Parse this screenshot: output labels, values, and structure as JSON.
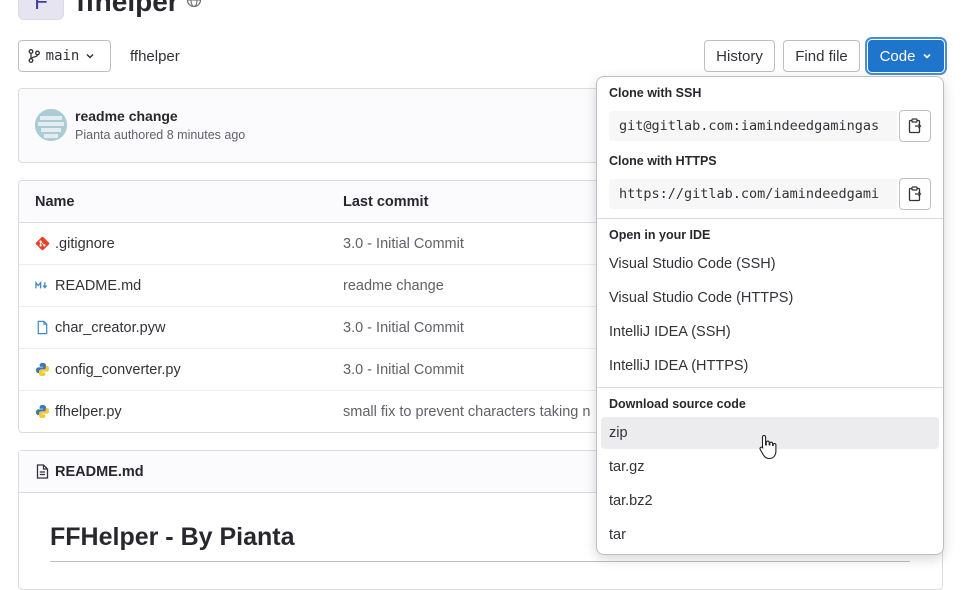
{
  "project": {
    "avatar_letter": "F",
    "name": "ffhelper"
  },
  "toolbar": {
    "branch": "main",
    "breadcrumb": "ffhelper",
    "history": "History",
    "find_file": "Find file",
    "code": "Code"
  },
  "last_commit": {
    "title": "readme change",
    "meta": "Pianta authored 8 minutes ago"
  },
  "file_table": {
    "headers": [
      "Name",
      "Last commit"
    ],
    "rows": [
      {
        "name": ".gitignore",
        "commit": "3.0 - Initial Commit",
        "icon": "git-icon"
      },
      {
        "name": "README.md",
        "commit": "readme change",
        "icon": "markdown-icon"
      },
      {
        "name": "char_creator.pyw",
        "commit": "3.0 - Initial Commit",
        "icon": "file-icon"
      },
      {
        "name": "config_converter.py",
        "commit": "3.0 - Initial Commit",
        "icon": "python-icon"
      },
      {
        "name": "ffhelper.py",
        "commit": "small fix to prevent characters taking n",
        "icon": "python-icon"
      }
    ]
  },
  "readme": {
    "header": "README.md",
    "heading": "FFHelper - By Pianta"
  },
  "code_dropdown": {
    "ssh_label": "Clone with SSH",
    "ssh_url": "git@gitlab.com:iamindeedgamingas",
    "https_label": "Clone with HTTPS",
    "https_url": "https://gitlab.com/iamindeedgami",
    "ide_label": "Open in your IDE",
    "ide_items": [
      "Visual Studio Code (SSH)",
      "Visual Studio Code (HTTPS)",
      "IntelliJ IDEA (SSH)",
      "IntelliJ IDEA (HTTPS)"
    ],
    "download_label": "Download source code",
    "download_items": [
      "zip",
      "tar.gz",
      "tar.bz2",
      "tar"
    ]
  },
  "colors": {
    "primary": "#1f75cb",
    "border": "#dcdcde",
    "text": "#333238",
    "muted": "#626168"
  }
}
